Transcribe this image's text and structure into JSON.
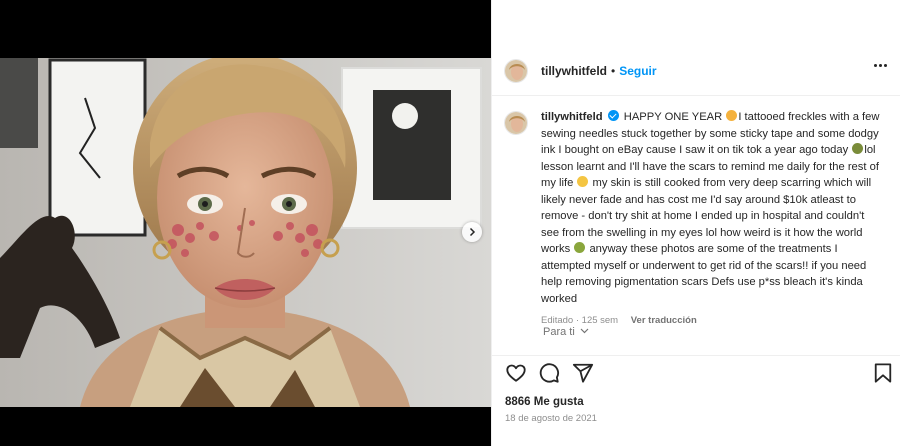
{
  "post": {
    "username": "tillywhitfeld",
    "separator": "•",
    "follow_label": "Seguir",
    "more_icon": "more-options-icon"
  },
  "caption": {
    "username": "tillywhitfeld",
    "part1": "HAPPY ONE YEAR",
    "part2": "I tattooed freckles with a few sewing needles stuck together by some sticky tape and some dodgy ink I bought on eBay cause I saw it on tik tok a year ago today",
    "part3": "lol lesson learnt and I'll have the scars to remind me daily for the rest of my life",
    "part4": "my skin is still cooked from very deep scarring which will likely never fade and has cost me I'd say around $10k atleast to remove - don't try shit at home I ended up in hospital and couldn't see from the swelling in my eyes lol how weird is it how the world works",
    "part5": "anyway these photos are some of the treatments I attempted myself or underwent to get rid of the scars!! if you need help removing pigmentation scars Defs use p*ss bleach it's kinda worked",
    "edited": "Editado · 125 sem",
    "translate": "Ver traducción"
  },
  "for_you": "Para ti",
  "actions": {
    "like_icon": "heart-icon",
    "comment_icon": "comment-icon",
    "share_icon": "share-icon",
    "save_icon": "bookmark-icon"
  },
  "likes": "8866 Me gusta",
  "date": "18 de agosto de 2021",
  "colors": {
    "accent": "#0095f6",
    "text": "#262626",
    "muted": "#8e8e8e"
  }
}
